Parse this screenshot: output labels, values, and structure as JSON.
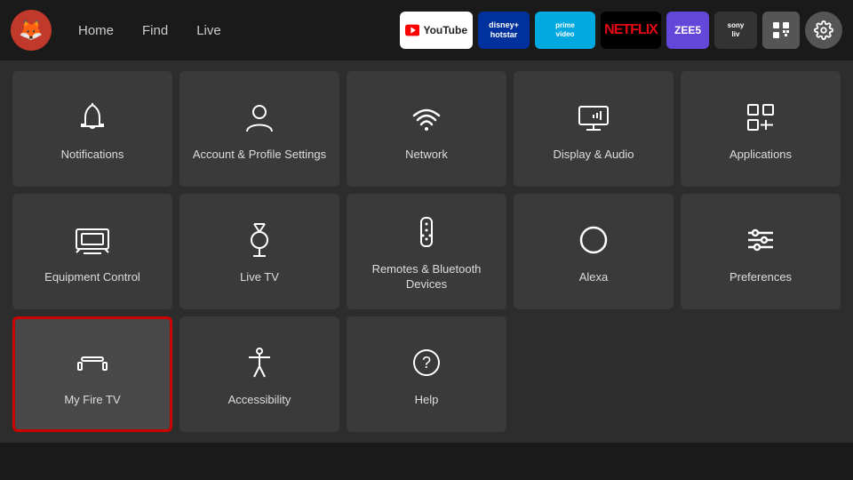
{
  "nav": {
    "logo": "🦊",
    "links": [
      {
        "label": "Home",
        "active": false
      },
      {
        "label": "Find",
        "active": false
      },
      {
        "label": "Live",
        "active": false
      }
    ]
  },
  "apps": [
    {
      "id": "youtube",
      "label": "YouTube"
    },
    {
      "id": "disney",
      "label": "disney+\nhotstar"
    },
    {
      "id": "prime",
      "label": "prime video"
    },
    {
      "id": "netflix",
      "label": "NETFLIX"
    },
    {
      "id": "zee5",
      "label": "ZEE5"
    },
    {
      "id": "sony",
      "label": "sony\nliv"
    },
    {
      "id": "grid",
      "label": "⊞"
    },
    {
      "id": "gear",
      "label": "⚙"
    }
  ],
  "tiles": [
    {
      "id": "notifications",
      "label": "Notifications",
      "icon": "bell"
    },
    {
      "id": "account-profile",
      "label": "Account & Profile Settings",
      "icon": "person"
    },
    {
      "id": "network",
      "label": "Network",
      "icon": "wifi"
    },
    {
      "id": "display-audio",
      "label": "Display & Audio",
      "icon": "display"
    },
    {
      "id": "applications",
      "label": "Applications",
      "icon": "apps"
    },
    {
      "id": "equipment-control",
      "label": "Equipment Control",
      "icon": "tv"
    },
    {
      "id": "live-tv",
      "label": "Live TV",
      "icon": "antenna"
    },
    {
      "id": "remotes-bluetooth",
      "label": "Remotes & Bluetooth Devices",
      "icon": "remote"
    },
    {
      "id": "alexa",
      "label": "Alexa",
      "icon": "alexa"
    },
    {
      "id": "preferences",
      "label": "Preferences",
      "icon": "sliders"
    },
    {
      "id": "my-fire-tv",
      "label": "My Fire TV",
      "icon": "firetv",
      "selected": true
    },
    {
      "id": "accessibility",
      "label": "Accessibility",
      "icon": "accessibility"
    },
    {
      "id": "help",
      "label": "Help",
      "icon": "help"
    }
  ]
}
